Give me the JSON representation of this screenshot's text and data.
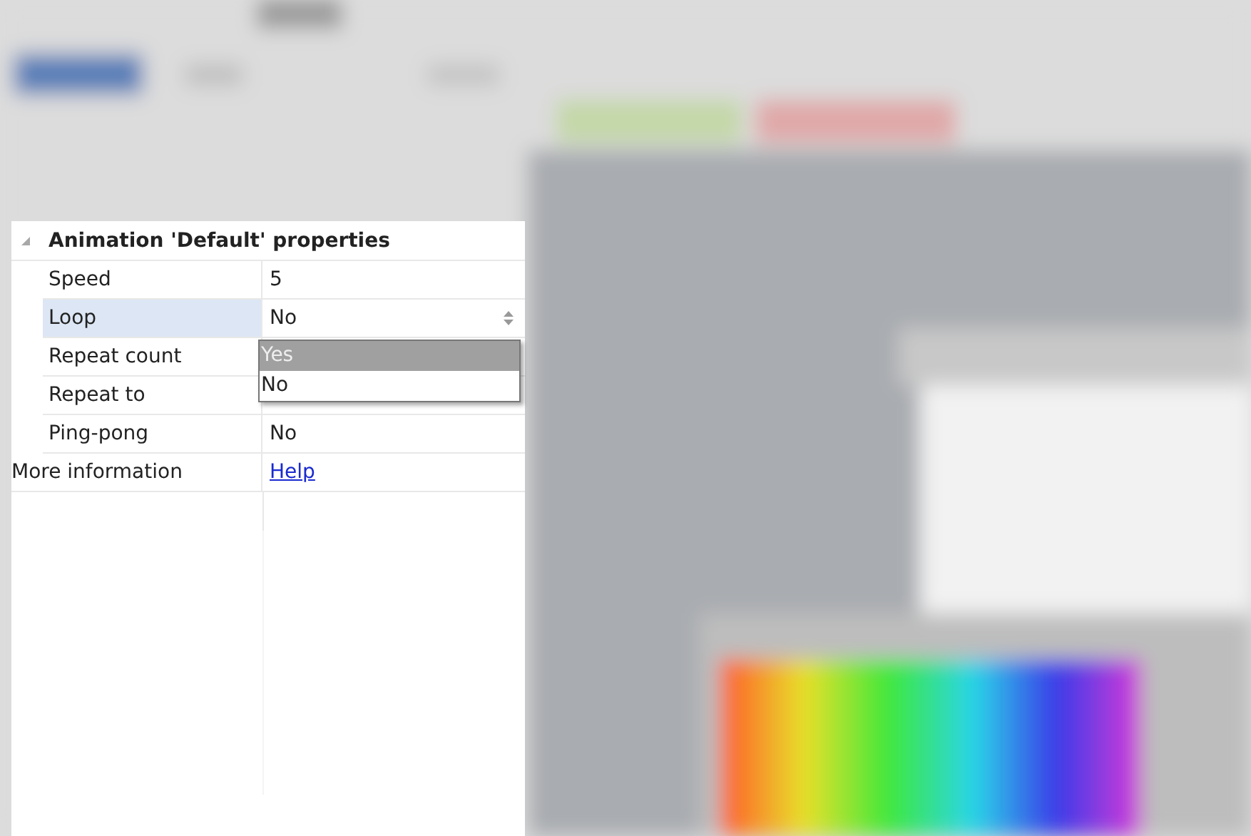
{
  "category": {
    "title": "Animation 'Default' properties",
    "expanded": true
  },
  "properties": [
    {
      "name": "Speed",
      "value": "5",
      "kind": "text",
      "selected": false
    },
    {
      "name": "Loop",
      "value": "No",
      "kind": "dropdown",
      "selected": true
    },
    {
      "name": "Repeat count",
      "selected": false
    },
    {
      "name": "Repeat to",
      "selected": false
    },
    {
      "name": "Ping-pong",
      "value": "No",
      "kind": "text",
      "selected": false
    }
  ],
  "more_information": {
    "name": "More information",
    "link": "Help"
  },
  "dropdown": {
    "options": [
      {
        "label": "Yes",
        "selected": true
      },
      {
        "label": "No",
        "selected": false
      }
    ]
  }
}
